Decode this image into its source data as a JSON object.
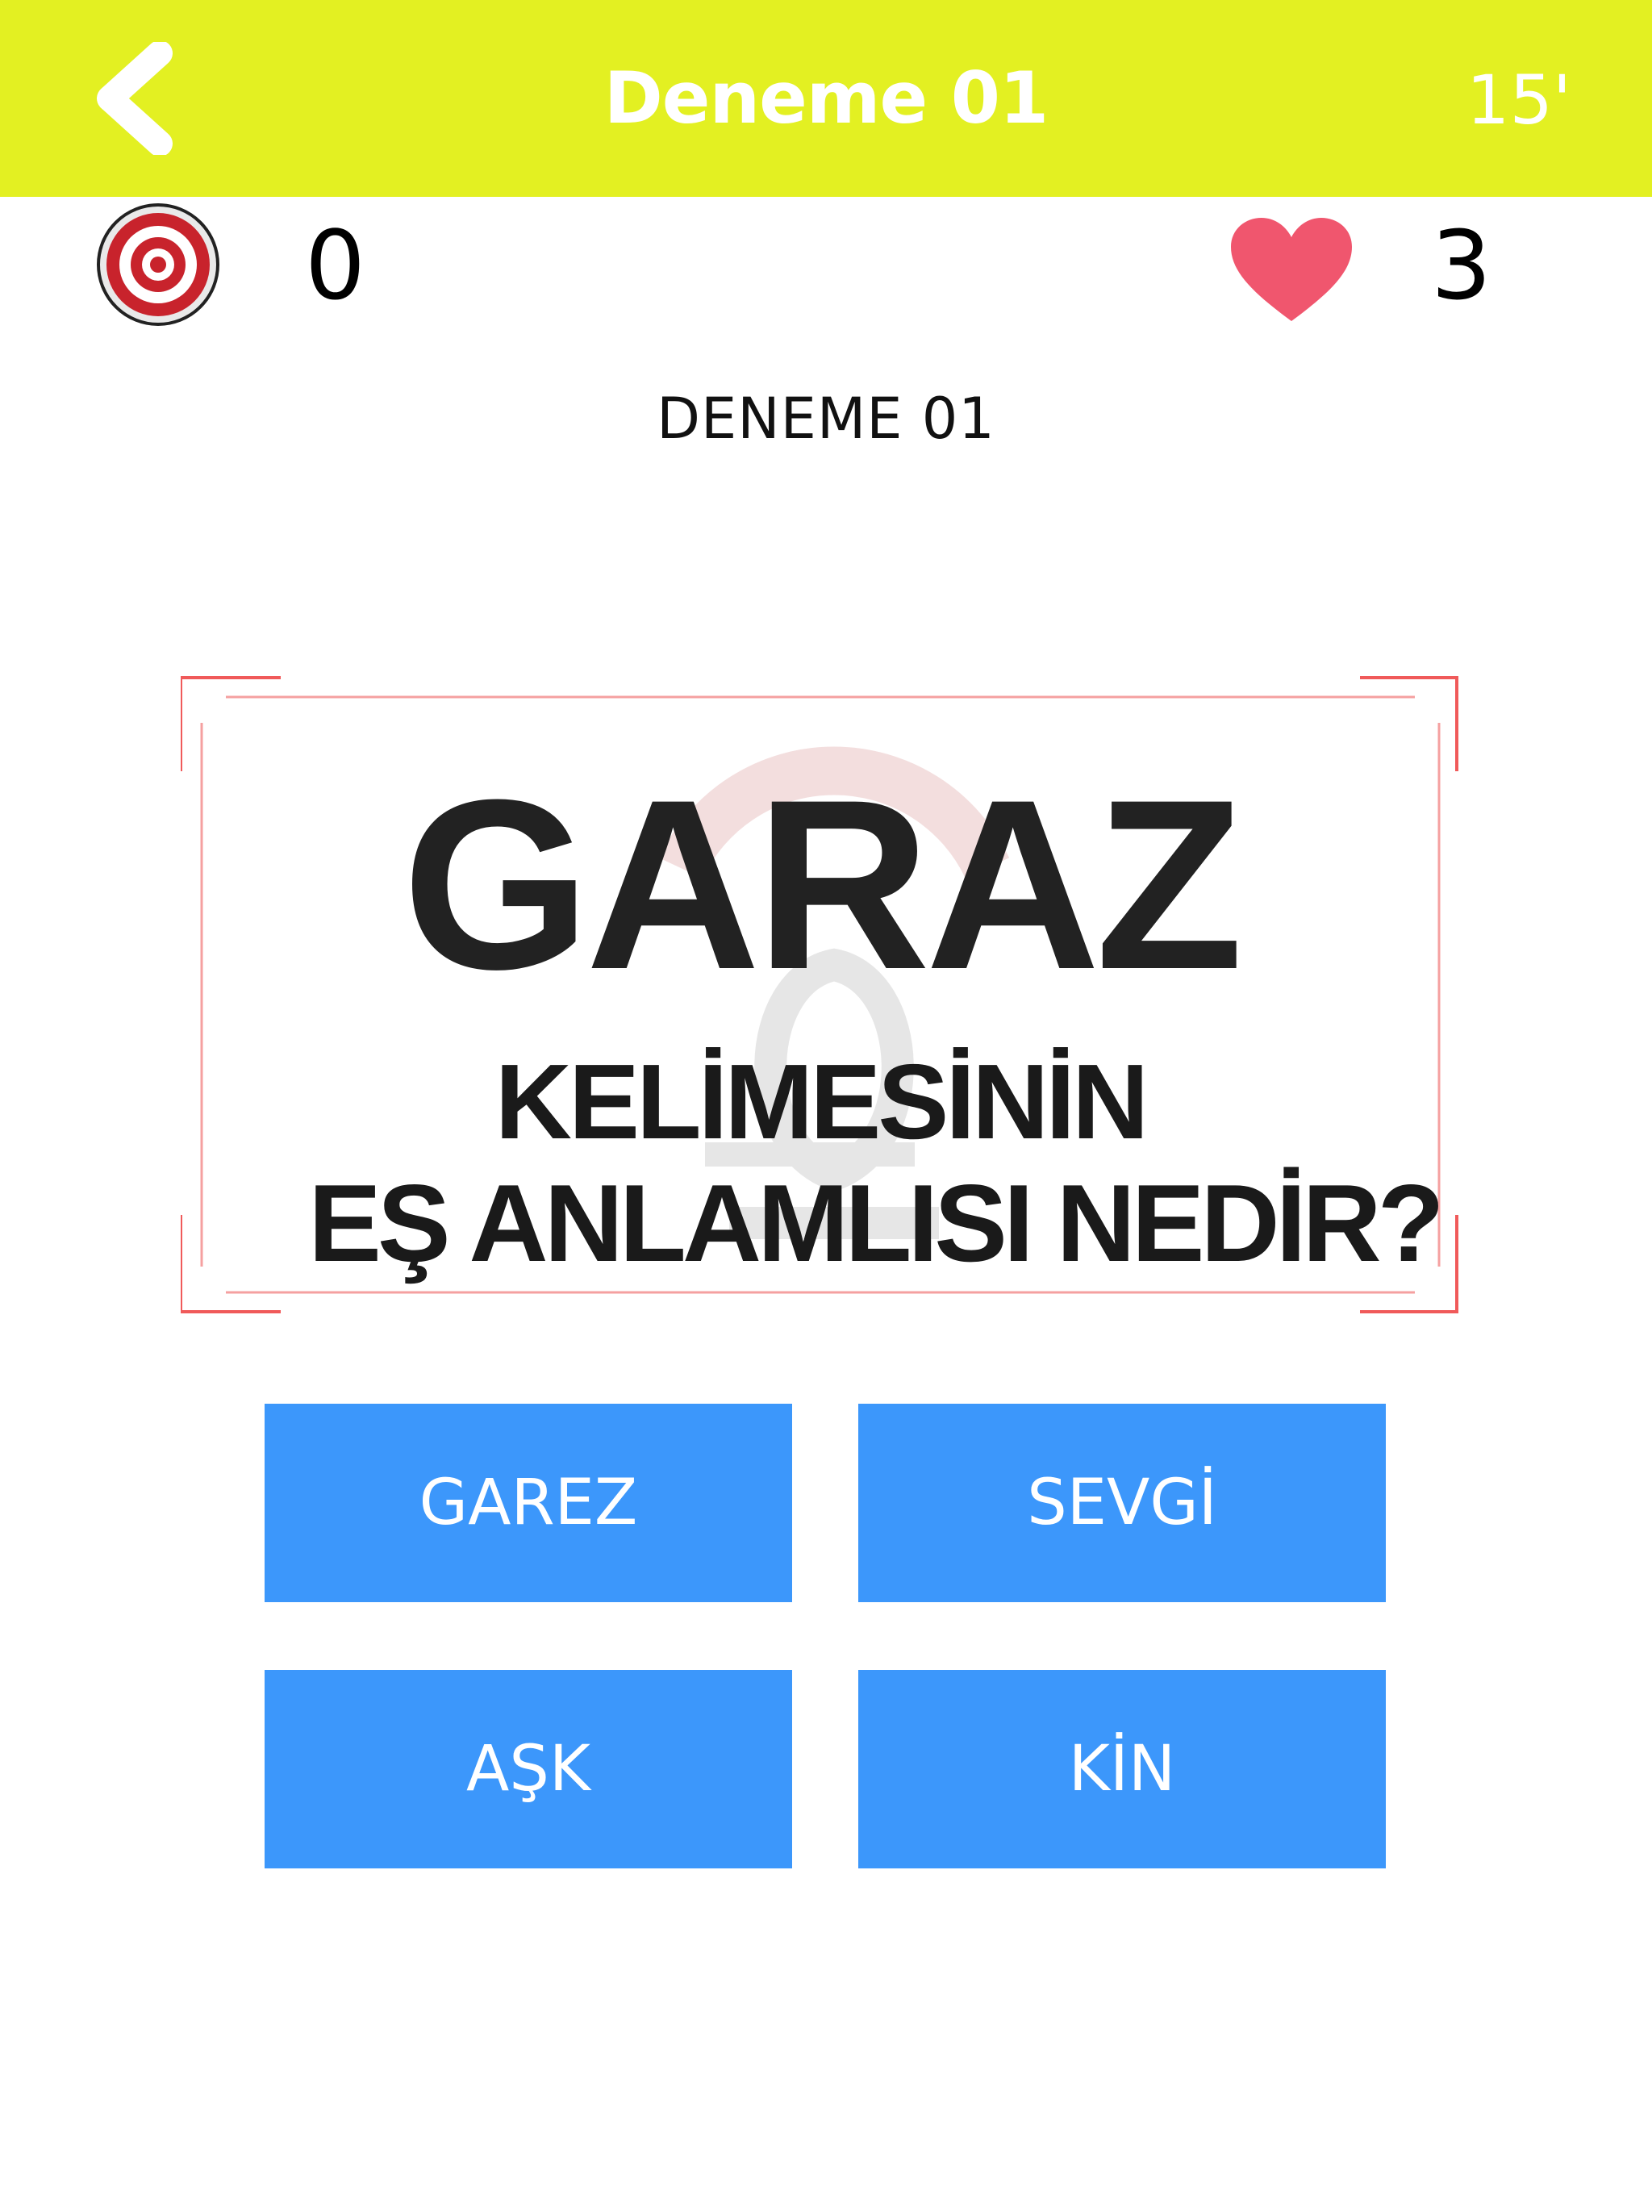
{
  "header": {
    "title": "Deneme 01",
    "timer": "15'"
  },
  "stats": {
    "score": "0",
    "lives": "3"
  },
  "subtitle": "DENEME 01",
  "question": {
    "word": "GARAZ",
    "line1": "KELİMESİNİN",
    "line2": "EŞ ANLAMLISI NEDİR?"
  },
  "answers": [
    {
      "label": "GAREZ"
    },
    {
      "label": "SEVGİ"
    },
    {
      "label": "AŞK"
    },
    {
      "label": "KİN"
    }
  ],
  "colors": {
    "header_bg": "#e3f022",
    "answer_bg": "#3c97fb",
    "frame_red": "#f05a5a",
    "heart": "#f0566e"
  },
  "icons": {
    "back": "chevron-left-icon",
    "target": "target-icon",
    "lives": "heart-icon"
  }
}
